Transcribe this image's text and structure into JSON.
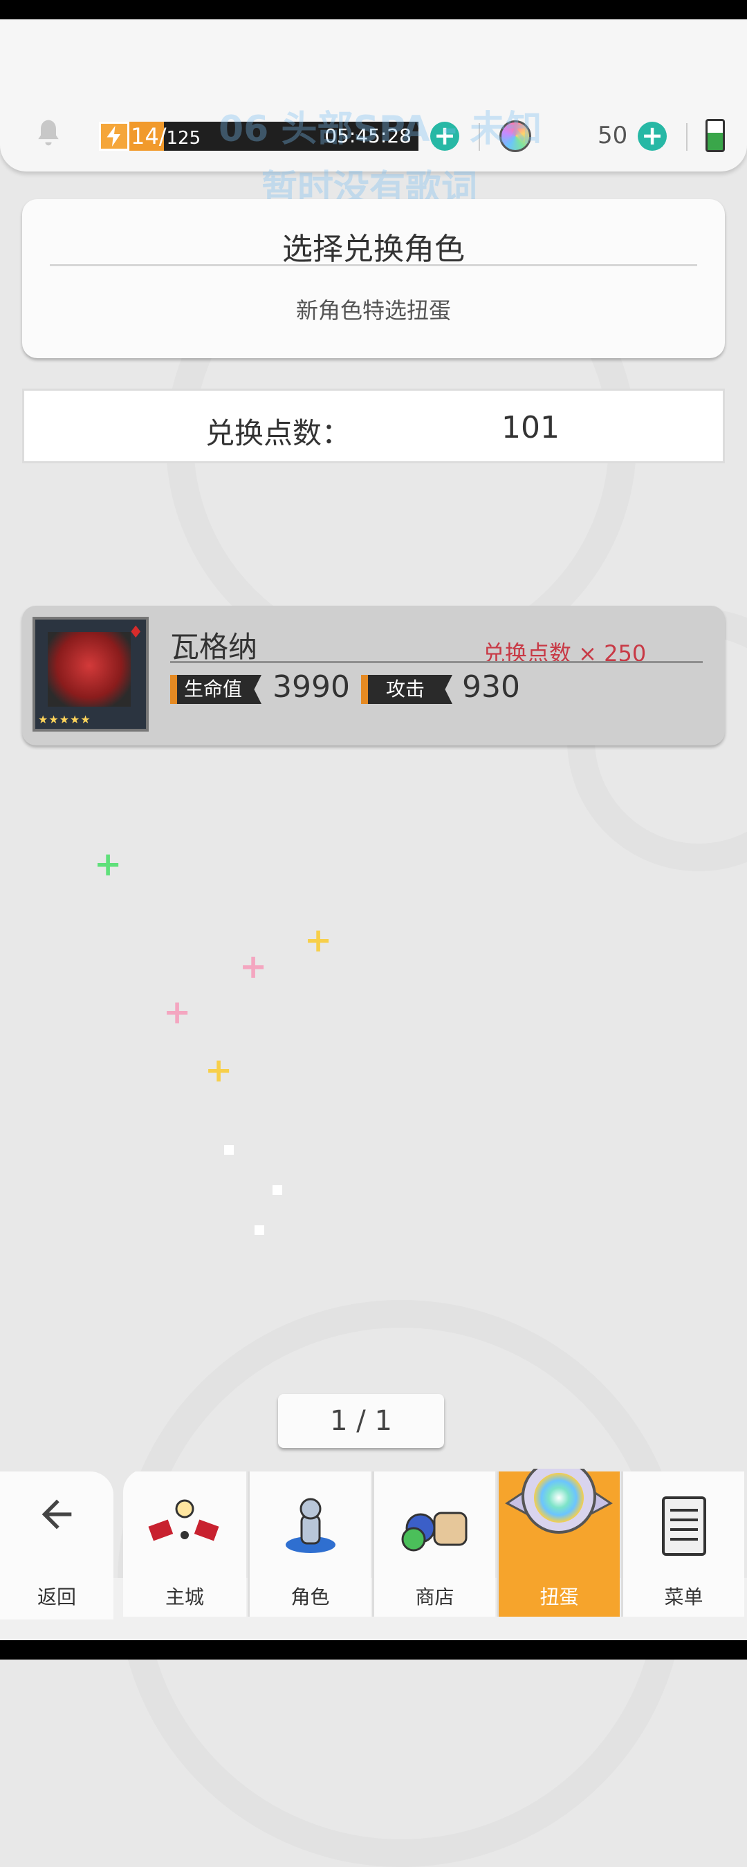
{
  "top_bar": {
    "energy_current": "14",
    "energy_separator": "/",
    "energy_max": "125",
    "energy_timer": "05:45:28",
    "gem_count": "50"
  },
  "overlay": {
    "lyric_line1": "06 头部SPA - 未知",
    "lyric_line2": "暂时没有歌词"
  },
  "panel": {
    "title": "选择兑换角色",
    "subtitle": "新角色特选扭蛋"
  },
  "points": {
    "label": "兑换点数：",
    "value": "101"
  },
  "character": {
    "name": "瓦格纳",
    "cost_label": "兑换点数 × 250",
    "hp_label": "生命值",
    "hp_value": "3990",
    "atk_label": "攻击",
    "atk_value": "930",
    "stars": "★★★★★",
    "suit": "♦"
  },
  "pager": {
    "text": "1 / 1"
  },
  "nav": {
    "back": "返回",
    "items": [
      {
        "label": "主城",
        "icon": "castle-icon"
      },
      {
        "label": "角色",
        "icon": "character-icon"
      },
      {
        "label": "商店",
        "icon": "shop-icon"
      },
      {
        "label": "扭蛋",
        "icon": "gacha-icon"
      },
      {
        "label": "菜单",
        "icon": "menu-icon"
      }
    ]
  },
  "colors": {
    "accent_orange": "#f6a42c",
    "plus_teal": "#27b8a5",
    "cost_red": "#c83a46"
  }
}
